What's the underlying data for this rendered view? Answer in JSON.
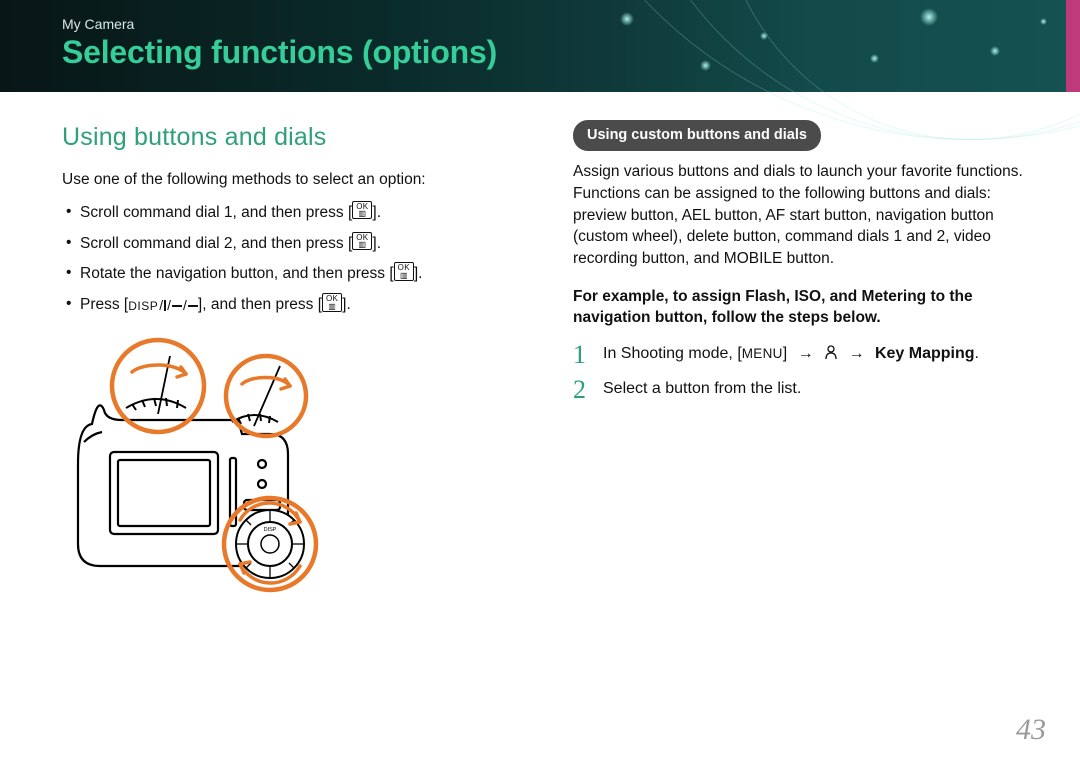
{
  "breadcrumb": "My Camera",
  "page_title": "Selecting functions (options)",
  "page_number": "43",
  "left": {
    "section_heading": "Using buttons and dials",
    "intro": "Use one of the following methods to select an option:",
    "ok_top": "OK",
    "ok_bot": "▥",
    "methods_pre": [
      "Scroll command dial 1, and then press [",
      "Scroll command dial 2, and then press [",
      "Rotate the navigation button, and then press [",
      "Press ["
    ],
    "methods_post": [
      "].",
      "].",
      "].",
      "], and then press ["
    ],
    "methods_tail": [
      "",
      "",
      "",
      "]."
    ],
    "pad_disp": "DISP",
    "camera_alt": "Line drawing of a camera body with three orange circles highlighting command dial 1, command dial 2, and the navigation button, each with rotation arrows."
  },
  "right": {
    "pill": "Using custom buttons and dials",
    "desc": "Assign various buttons and dials to launch your favorite functions. Functions can be assigned to the following buttons and dials: preview button, AEL button, AF start button, navigation button (custom wheel), delete button, command dials 1 and 2, video recording button, and MOBILE button.",
    "example": "For example, to assign Flash, ISO, and Metering to the navigation button, follow the steps below.",
    "steps": [
      {
        "num": "1",
        "pre": "In Shooting mode, [",
        "menu": "MENU",
        "mid1": "] ",
        "arrow": "→",
        "mid2": " ",
        "gear": "gear",
        "mid3": " ",
        "arrow2": "→",
        "tail": " ",
        "bold": "Key Mapping",
        "end": "."
      },
      {
        "num": "2",
        "text": "Select a button from the list."
      }
    ]
  }
}
